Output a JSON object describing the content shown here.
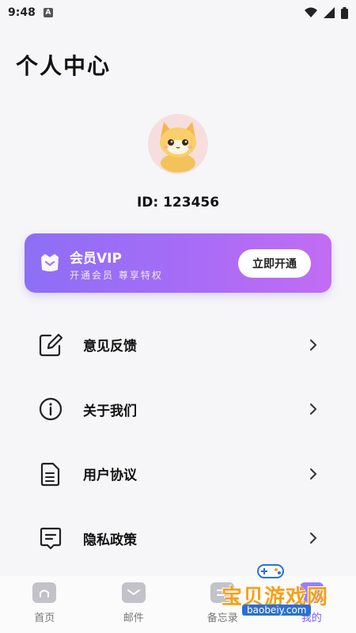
{
  "status_bar": {
    "time": "9:48",
    "badge": "A"
  },
  "header": {
    "title": "个人中心"
  },
  "profile": {
    "id_text": "ID: 123456"
  },
  "vip": {
    "title": "会员VIP",
    "subtitle": "开通会员 尊享特权",
    "button": "立即开通"
  },
  "menu": [
    {
      "label": "意见反馈",
      "icon": "edit-icon"
    },
    {
      "label": "关于我们",
      "icon": "info-icon"
    },
    {
      "label": "用户协议",
      "icon": "document-icon"
    },
    {
      "label": "隐私政策",
      "icon": "message-icon"
    }
  ],
  "tabbar": {
    "items": [
      {
        "label": "首页",
        "icon": "home-icon"
      },
      {
        "label": "邮件",
        "icon": "mail-icon"
      },
      {
        "label": "备忘录",
        "icon": "memo-icon"
      },
      {
        "label": "我的",
        "icon": "profile-icon",
        "active": true
      }
    ]
  },
  "watermark": {
    "text": "宝贝游戏网",
    "url": "baobeiy.com"
  },
  "colors": {
    "accent": "#7b5cf0",
    "vip_start": "#8c6ff5",
    "vip_end": "#c26cf3"
  }
}
